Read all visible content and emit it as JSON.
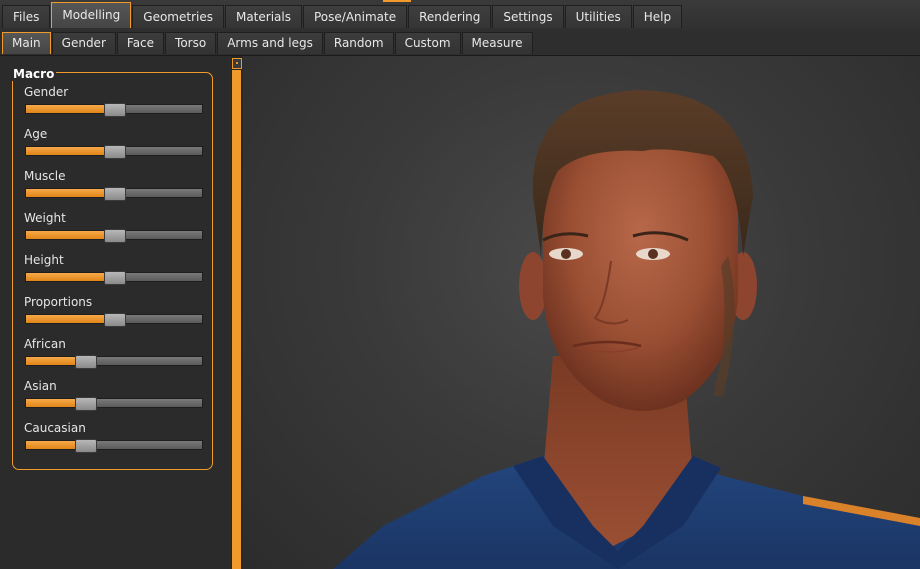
{
  "main_tabs": [
    {
      "label": "Files",
      "active": false
    },
    {
      "label": "Modelling",
      "active": true
    },
    {
      "label": "Geometries",
      "active": false
    },
    {
      "label": "Materials",
      "active": false
    },
    {
      "label": "Pose/Animate",
      "active": false
    },
    {
      "label": "Rendering",
      "active": false
    },
    {
      "label": "Settings",
      "active": false
    },
    {
      "label": "Utilities",
      "active": false
    },
    {
      "label": "Help",
      "active": false
    }
  ],
  "sub_tabs": [
    {
      "label": "Main",
      "active": true
    },
    {
      "label": "Gender",
      "active": false
    },
    {
      "label": "Face",
      "active": false
    },
    {
      "label": "Torso",
      "active": false
    },
    {
      "label": "Arms and legs",
      "active": false
    },
    {
      "label": "Random",
      "active": false
    },
    {
      "label": "Custom",
      "active": false
    },
    {
      "label": "Measure",
      "active": false
    }
  ],
  "macro": {
    "title": "Macro",
    "sliders": [
      {
        "label": "Gender",
        "value": 0.5
      },
      {
        "label": "Age",
        "value": 0.5
      },
      {
        "label": "Muscle",
        "value": 0.5
      },
      {
        "label": "Weight",
        "value": 0.5
      },
      {
        "label": "Height",
        "value": 0.5
      },
      {
        "label": "Proportions",
        "value": 0.5
      },
      {
        "label": "African",
        "value": 0.333
      },
      {
        "label": "Asian",
        "value": 0.333
      },
      {
        "label": "Caucasian",
        "value": 0.333
      }
    ]
  },
  "colors": {
    "accent": "#f19a2c",
    "background": "#2b2b2b",
    "skin": "#a85a3c",
    "hair": "#4a3322",
    "shirt": "#1f3f74"
  },
  "viewport": {
    "content": "3D human model"
  }
}
